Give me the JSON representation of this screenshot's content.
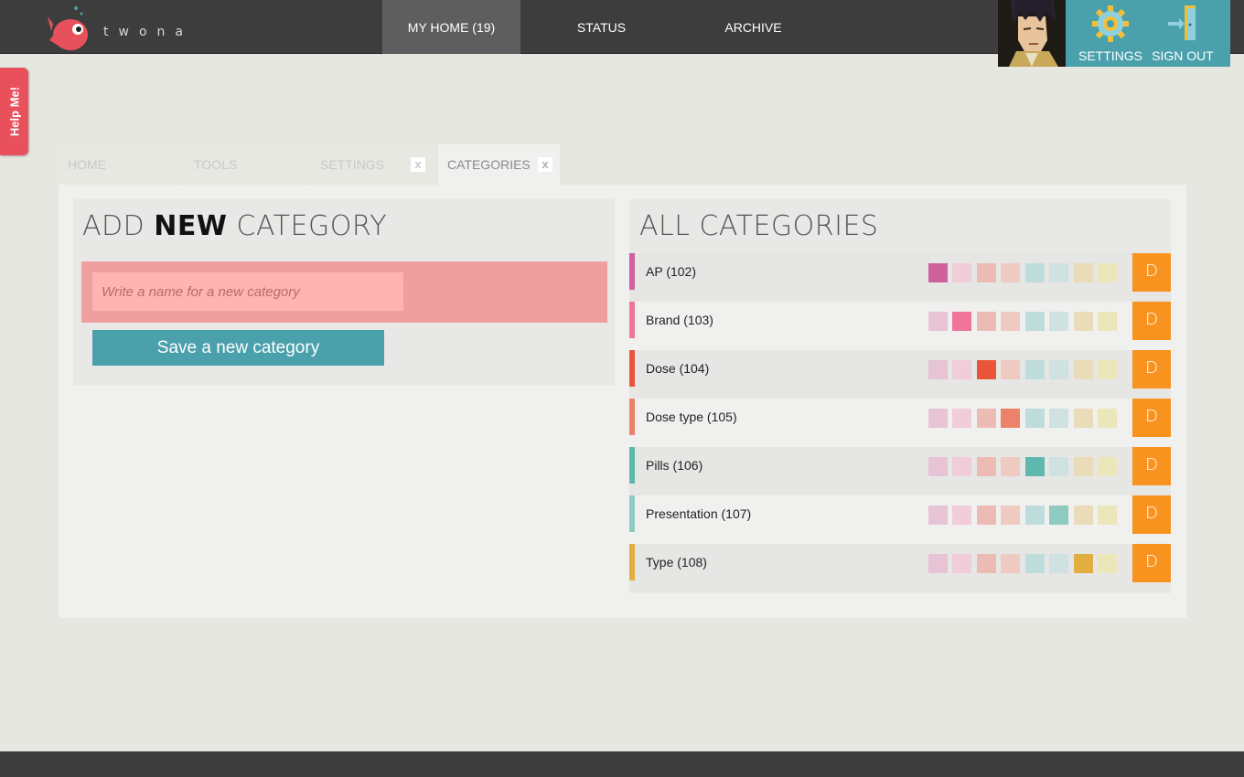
{
  "brand": {
    "name": "twona"
  },
  "nav": [
    {
      "label": "MY HOME (19)",
      "active": true
    },
    {
      "label": "STATUS",
      "active": false
    },
    {
      "label": "ARCHIVE",
      "active": false
    }
  ],
  "user": {
    "settings_label": "SETTINGS",
    "signout_label": "SIGN OUT"
  },
  "help": {
    "label": "Help Me!"
  },
  "tabs": [
    {
      "label": "HOME",
      "closable": false
    },
    {
      "label": "TOOLS",
      "closable": false
    },
    {
      "label": "SETTINGS",
      "closable": true
    },
    {
      "label": "CATEGORIES",
      "closable": true
    }
  ],
  "tab_close_glyph": "x",
  "add_category": {
    "heading_pre": "ADD",
    "heading_bold": "NEW",
    "heading_post": "CATEGORY",
    "placeholder": "Write a name for a new category",
    "save_label": "Save a new category"
  },
  "all_categories": {
    "heading": "ALL CATEGORIES",
    "delete_label": "D",
    "palette_selected": [
      "#d0609b",
      "#ef769a",
      "#e95539",
      "#eb8269",
      "#5fb8ae",
      "#8fcbc1",
      "#e2ae3f",
      "#e6e2b0"
    ],
    "palette_light": [
      "#e6c3d5",
      "#f0cdd8",
      "#ecbcb4",
      "#efcac0",
      "#bfdcdc",
      "#cfe1e0",
      "#eadcb8",
      "#ece6bb"
    ],
    "rows": [
      {
        "name": "AP (102)",
        "color": "#d0609b",
        "selected": 0
      },
      {
        "name": "Brand (103)",
        "color": "#ef769a",
        "selected": 1
      },
      {
        "name": "Dose (104)",
        "color": "#e95539",
        "selected": 2
      },
      {
        "name": "Dose type (105)",
        "color": "#eb8269",
        "selected": 3
      },
      {
        "name": "Pills (106)",
        "color": "#5fb8ae",
        "selected": 4
      },
      {
        "name": "Presentation (107)",
        "color": "#8fcbc1",
        "selected": 5
      },
      {
        "name": "Type (108)",
        "color": "#e2ae3f",
        "selected": 6
      }
    ]
  }
}
